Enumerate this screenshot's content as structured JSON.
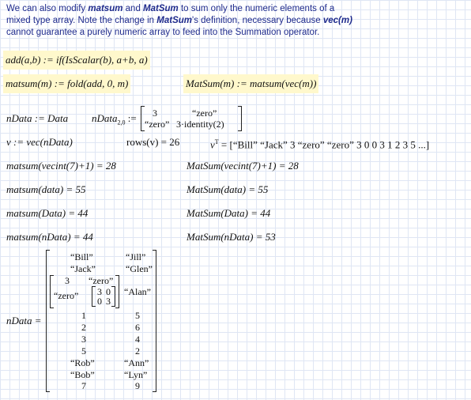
{
  "note": {
    "line1_pre": "We can also modify ",
    "matsum": "matsum",
    "and": " and ",
    "MatSum": "MatSum",
    "line1_post": " to sum only the numeric elements of a mixed type array.  Note the change in ",
    "MatSum2": "MatSum",
    "line2_post": "'s definition, necessary because ",
    "vecm": "vec(m)",
    "line3": " cannot guarantee a purely numeric array to feed into the Summation operator."
  },
  "defs": {
    "add": "add(a,b) := if(IsScalar(b), a+b, a)",
    "matsum_def": "matsum(m) := fold(add, 0, m)",
    "MatSum_def": "MatSum(m) := matsum(vec(m))"
  },
  "ndata": {
    "assign_lhs": "nData := Data",
    "sub_lhs": "nData",
    "sub_idx": "2,0",
    "assign_op": ":=",
    "m00": "3",
    "m01": "“zero”",
    "m10": "“zero”",
    "m11": "3·identity(2)"
  },
  "vec": {
    "v_def": "v := vec(nData)",
    "rows": "rows(v) = 26",
    "vT_lhs": "v",
    "vT_sup": "T",
    "vT_rhs": "= [“Bill” “Jack” 3 “zero” “zero” 3 0 0 3 1 2 3 5 ...]"
  },
  "results": [
    {
      "left": "matsum(vecint(7)+1) = 28",
      "right": "MatSum(vecint(7)+1) = 28"
    },
    {
      "left": "matsum(data) = 55",
      "right": "MatSum(data) = 55"
    },
    {
      "left": "matsum(Data) = 44",
      "right": "MatSum(Data) = 44"
    },
    {
      "left": "matsum(nData) = 44",
      "right": "MatSum(nData) = 53"
    }
  ],
  "matrix": {
    "lhs": "nData =",
    "top": [
      [
        "“Bill”",
        "“Jill”"
      ],
      [
        "“Jack”",
        "“Glen”"
      ]
    ],
    "nested_right": "“Alan”",
    "nested": {
      "r0c0": "3",
      "r0c1": "“zero”",
      "r1c0": "“zero”",
      "inner": [
        [
          "3",
          "0"
        ],
        [
          "0",
          "3"
        ]
      ]
    },
    "rows": [
      [
        "1",
        "5"
      ],
      [
        "2",
        "6"
      ],
      [
        "3",
        "4"
      ],
      [
        "5",
        "2"
      ],
      [
        "“Rob”",
        "“Ann”"
      ],
      [
        "“Bob”",
        "“Lyn”"
      ],
      [
        "7",
        "9"
      ]
    ]
  }
}
